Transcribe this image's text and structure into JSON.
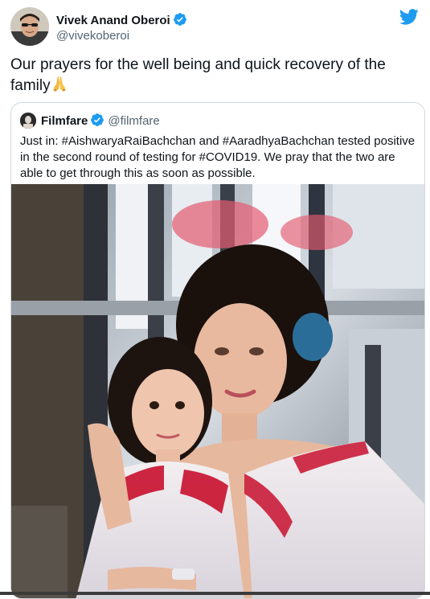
{
  "author": {
    "name": "Vivek Anand Oberoi",
    "handle": "@vivekoberoi",
    "verified": true,
    "avatar": "profile-photo-man-with-sunglasses"
  },
  "tweet": {
    "text": "Our prayers for the well being and quick recovery of the family",
    "emoji": "folded-hands-emoji"
  },
  "quoted_tweet": {
    "name": "Filmfare",
    "handle": "@filmfare",
    "verified": true,
    "text": "Just in: #AishwaryaRaiBachchan and #AaradhyaBachchan tested positive in the second round of testing for #COVID19. We pray that the two are able to get through this as soon as possible.",
    "image": "photo-woman-and-girl-in-sparkly-dresses"
  },
  "colors": {
    "twitter_blue": "#1d9bf0",
    "text_primary": "#0f1419",
    "text_secondary": "#536471",
    "border": "#cfd9de"
  },
  "icons": {
    "platform": "twitter-bird-icon",
    "verified": "verified-badge-icon"
  }
}
